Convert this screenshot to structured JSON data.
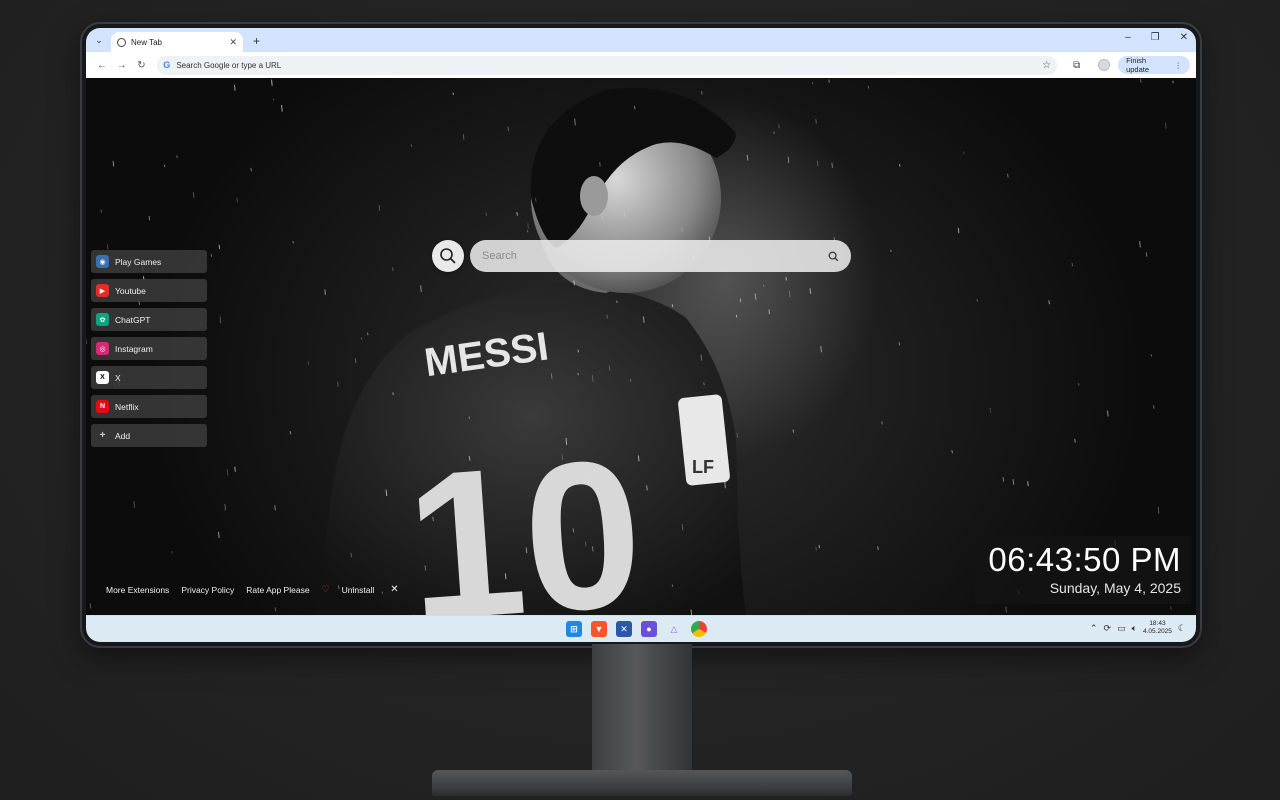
{
  "browser": {
    "tab_title": "New Tab",
    "omnibox_placeholder": "Search Google or type a URL",
    "finish_update_label": "Finish update"
  },
  "search": {
    "placeholder": "Search"
  },
  "shortcuts": [
    {
      "label": "Play Games",
      "icon": "games-icon",
      "color": "#3a6fb0"
    },
    {
      "label": "Youtube",
      "icon": "youtube-icon",
      "color": "#e52d27"
    },
    {
      "label": "ChatGPT",
      "icon": "chatgpt-icon",
      "color": "#10a37f"
    },
    {
      "label": "Instagram",
      "icon": "instagram-icon",
      "color": "#d62976"
    },
    {
      "label": "X",
      "icon": "x-icon",
      "color": "#ffffff"
    },
    {
      "label": "Netflix",
      "icon": "netflix-icon",
      "color": "#e50914"
    },
    {
      "label": "Add",
      "icon": "plus-icon",
      "color": "#cccccc"
    }
  ],
  "footer": {
    "more_extensions": "More Extensions",
    "privacy_policy": "Privacy Policy",
    "rate_app": "Rate App Please",
    "uninstall": "Uninstall"
  },
  "clock": {
    "time": "06:43:50 PM",
    "date": "Sunday, May 4, 2025"
  },
  "taskbar": {
    "tray_time": "18:43",
    "tray_date": "4.05.2025"
  }
}
